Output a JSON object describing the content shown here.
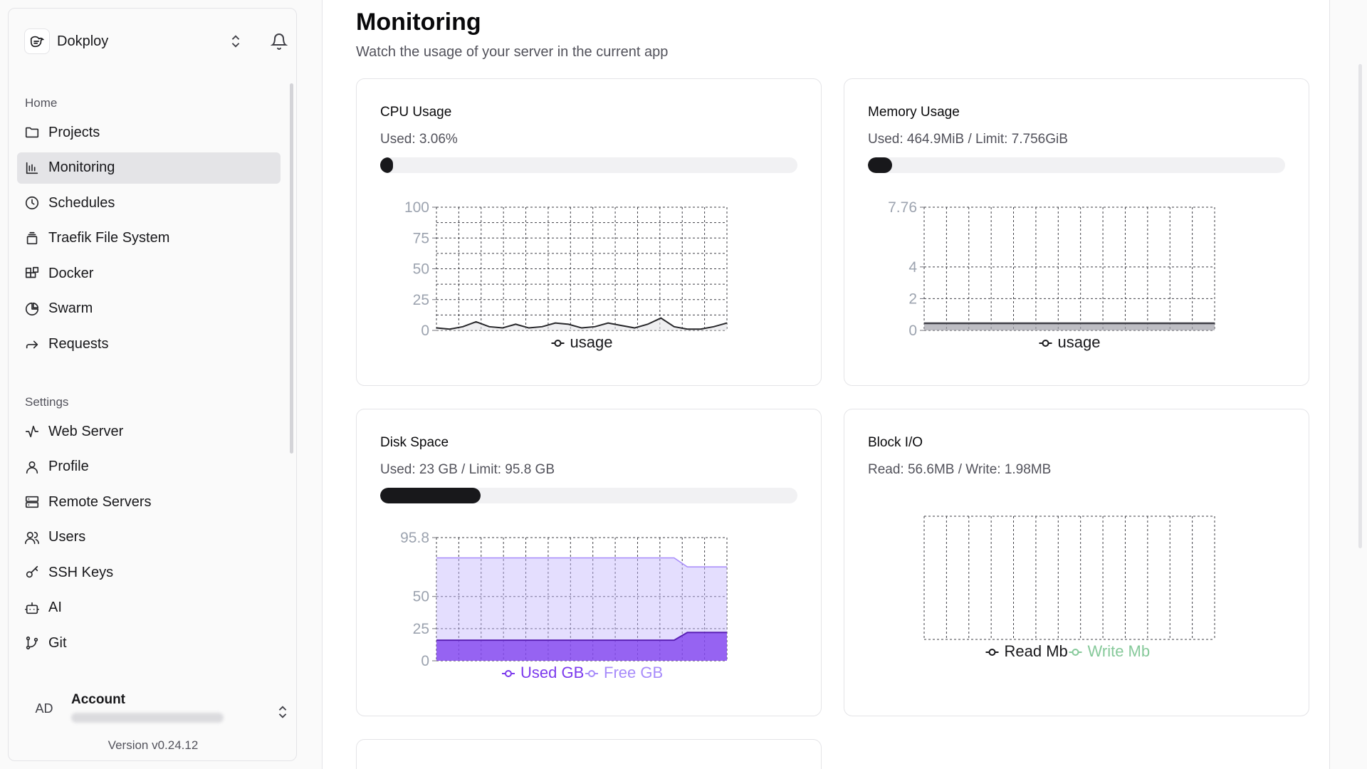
{
  "sidebar": {
    "brand": "Dokploy",
    "home_label": "Home",
    "home_items": [
      {
        "label": "Projects",
        "icon": "folder-icon"
      },
      {
        "label": "Monitoring",
        "icon": "bar-chart-icon",
        "active": true
      },
      {
        "label": "Schedules",
        "icon": "clock-icon"
      },
      {
        "label": "Traefik File System",
        "icon": "file-stack-icon"
      },
      {
        "label": "Docker",
        "icon": "blocks-icon"
      },
      {
        "label": "Swarm",
        "icon": "pie-chart-icon"
      },
      {
        "label": "Requests",
        "icon": "forward-arrow-icon"
      }
    ],
    "settings_label": "Settings",
    "settings_items": [
      {
        "label": "Web Server",
        "icon": "activity-icon"
      },
      {
        "label": "Profile",
        "icon": "user-icon"
      },
      {
        "label": "Remote Servers",
        "icon": "server-icon"
      },
      {
        "label": "Users",
        "icon": "users-icon"
      },
      {
        "label": "SSH Keys",
        "icon": "key-icon"
      },
      {
        "label": "AI",
        "icon": "bot-icon"
      },
      {
        "label": "Git",
        "icon": "git-branch-icon"
      }
    ],
    "account": {
      "initials": "AD",
      "name": "Account"
    },
    "version": "Version v0.24.12"
  },
  "page": {
    "title": "Monitoring",
    "subtitle": "Watch the usage of your server in the current app"
  },
  "cards": {
    "cpu": {
      "title": "CPU Usage",
      "sub": "Used: 3.06%",
      "progress": 0.0306
    },
    "memory": {
      "title": "Memory Usage",
      "sub": "Used: 464.9MiB / Limit: 7.756GiB",
      "progress": 0.0585
    },
    "disk": {
      "title": "Disk Space",
      "sub": "Used: 23 GB / Limit: 95.8 GB",
      "progress": 0.24
    },
    "block": {
      "title": "Block I/O",
      "sub": "Read: 56.6MB / Write: 1.98MB"
    }
  },
  "colors": {
    "used": "#7c3aed",
    "free": "#a78bfa",
    "write": "#86c99a",
    "dark": "#18181b"
  },
  "chart_data": [
    {
      "id": "cpu",
      "type": "line",
      "yticks": [
        0,
        25,
        50,
        75,
        100
      ],
      "ylim": [
        0,
        100
      ],
      "series": [
        {
          "name": "usage",
          "values": [
            2,
            1,
            3,
            7,
            3,
            2,
            5,
            2,
            3,
            6,
            5,
            2,
            3,
            6,
            4,
            2,
            5,
            10,
            3,
            1,
            1,
            3,
            6
          ]
        }
      ]
    },
    {
      "id": "memory",
      "type": "area",
      "yticks": [
        0,
        2,
        4,
        7.76
      ],
      "ylim": [
        0,
        7.76
      ],
      "series": [
        {
          "name": "usage",
          "values": [
            0.45,
            0.45,
            0.45,
            0.45,
            0.45,
            0.45,
            0.45,
            0.45,
            0.45,
            0.45,
            0.45,
            0.45,
            0.45,
            0.45,
            0.45,
            0.45,
            0.45,
            0.45,
            0.45,
            0.45,
            0.45,
            0.45,
            0.45
          ]
        }
      ]
    },
    {
      "id": "disk",
      "type": "area",
      "yticks": [
        0,
        25,
        50,
        95.8
      ],
      "ylim": [
        0,
        95.8
      ],
      "series": [
        {
          "name": "Used GB",
          "values": [
            16,
            16,
            16,
            16,
            16,
            16,
            16,
            16,
            16,
            16,
            16,
            16,
            16,
            16,
            16,
            16,
            16,
            16,
            16,
            22,
            22,
            22,
            22
          ]
        },
        {
          "name": "Free GB",
          "values": [
            80,
            80,
            80,
            80,
            80,
            80,
            80,
            80,
            80,
            80,
            80,
            80,
            80,
            80,
            80,
            80,
            80,
            80,
            80,
            73,
            73,
            73,
            73
          ]
        }
      ]
    },
    {
      "id": "block",
      "type": "line",
      "yticks": [],
      "series": [
        {
          "name": "Read Mb",
          "values": []
        },
        {
          "name": "Write Mb",
          "values": []
        }
      ]
    }
  ]
}
